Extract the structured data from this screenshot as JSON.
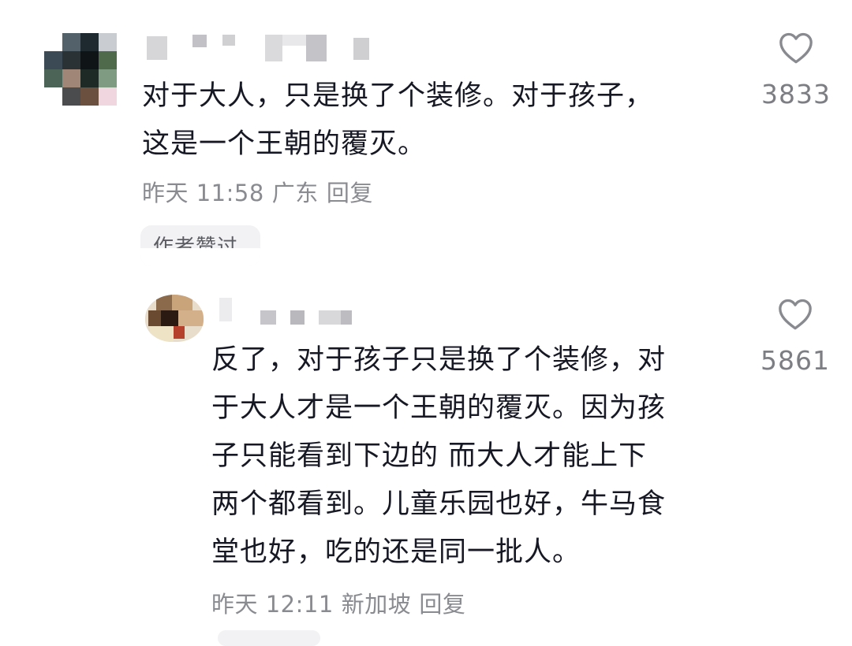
{
  "comments": [
    {
      "text_lines": [
        "对于大人，只是换了个装修。对于孩子，",
        "这是一个王朝的覆灭。"
      ],
      "time": "昨天 11:58",
      "location": "广东",
      "reply_label": "回复",
      "badge": "作者赞过",
      "like_icon": "heart-outline-icon",
      "like_count": "3833"
    },
    {
      "text_lines": [
        "反了，对于孩子只是换了个装修，对",
        "于大人才是一个王朝的覆灭。因为孩",
        "子只能看到下边的 而大人才能上下",
        "两个都看到。儿童乐园也好，牛马食",
        "堂也好，吃的还是同一批人。"
      ],
      "time": "昨天 12:11",
      "location": "新加坡",
      "reply_label": "回复",
      "like_icon": "heart-outline-icon",
      "like_count": "5861"
    }
  ],
  "colors": {
    "text": "#161823",
    "meta": "#8a8b91",
    "like_count": "#7d7e84",
    "badge_bg": "#f2f2f4"
  }
}
